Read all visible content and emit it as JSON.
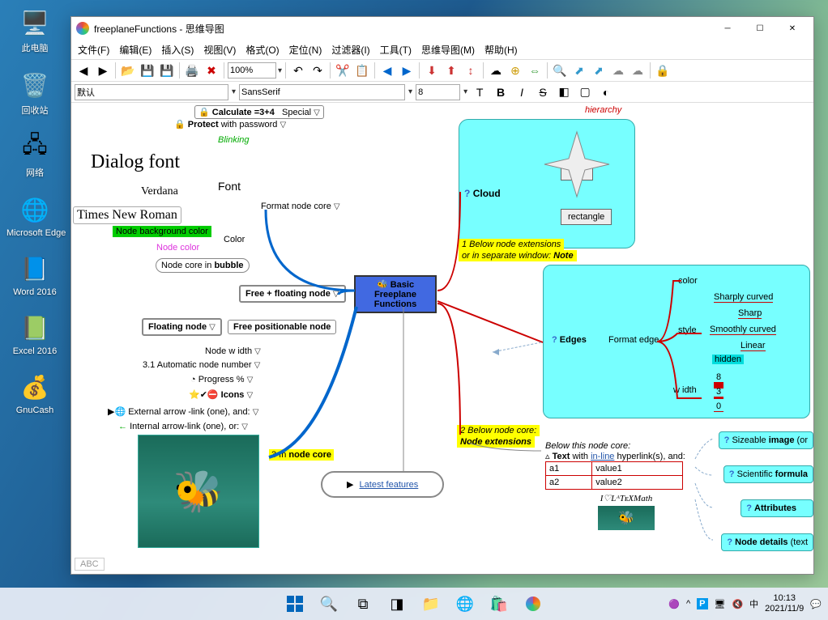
{
  "desktop": {
    "icons": [
      {
        "label": "此电脑",
        "glyph": "🖥️"
      },
      {
        "label": "回收站",
        "glyph": "🗑️"
      },
      {
        "label": "网络",
        "glyph": "🖧"
      },
      {
        "label": "Microsoft Edge",
        "glyph": "🌐"
      },
      {
        "label": "Word 2016",
        "glyph": "📘"
      },
      {
        "label": "Excel 2016",
        "glyph": "📗"
      },
      {
        "label": "GnuCash",
        "glyph": "💰"
      }
    ]
  },
  "window": {
    "title": "freeplaneFunctions - 思维导图",
    "menus": [
      "文件(F)",
      "编辑(E)",
      "插入(S)",
      "视图(V)",
      "格式(O)",
      "定位(N)",
      "过滤器(I)",
      "工具(T)",
      "思维导图(M)",
      "帮助(H)"
    ],
    "zoom": "100%",
    "style_combo": "默认",
    "font_combo": "SansSerif",
    "size_combo": "8",
    "status_left": "ABC"
  },
  "mm": {
    "root": "Basic Freeplane Functions",
    "latest_features": "Latest features",
    "calculate": "Calculate =3+4",
    "protect_label1": "Protect",
    "protect_label2": " with password",
    "blinking": "Blinking",
    "dialog_font": "Dialog font",
    "font_label": "Font",
    "verdana": "Verdana",
    "times": "Times New Roman",
    "format_node_core": "Format node core",
    "node_bg": "Node background color",
    "color": "Color",
    "node_color": "Node color",
    "node_bubble1": "Node core in ",
    "node_bubble2": "bubble",
    "free_floating": "Free + floating node",
    "floating": "Floating node",
    "free_position": "Free positionable node",
    "node_width": "Node w idth",
    "auto_number": "3.1 Automatic node number",
    "progress": "Progress %",
    "icons": "Icons",
    "ext_arrow": "External arrow -link (one), and:",
    "int_arrow": "Internal arrow-link (one), or:",
    "in_node_core": "3 In node core",
    "below1a": "1 Below node extensions",
    "below1b": "or in separate window: ",
    "below1c": "Note",
    "below2a": "2 Below node core:",
    "below2b": "Node extensions",
    "cloud": "Cloud",
    "star": "star",
    "rectangle": "rectangle",
    "hierarchy": "hierarchy",
    "edges": "Edges",
    "format_edge": "Format edge",
    "edge_color": "color",
    "edge_style": "style",
    "edge_width": "w idth",
    "sharply": "Sharply curved",
    "sharp": "Sharp",
    "smoothly": "Smoothly curved",
    "linear": "Linear",
    "hidden": "hidden",
    "w8": "8",
    "w3": "3",
    "w0": "0",
    "below_core": "Below this node core:",
    "text_with1": "Text",
    "text_with2": " with ",
    "text_with3": "in-line",
    "text_with4": " hyperlink(s), and:",
    "a1": "a1",
    "v1": "value1",
    "a2": "a2",
    "v2": "value2",
    "latex": "I♡LᴬTᴇXMath",
    "sizeable": "Sizeable ",
    "sizeable2": "image",
    "sizeable3": " (or",
    "scientific1": "Scientific ",
    "scientific2": "formula",
    "attributes": "Attributes",
    "node_details1": "Node details",
    "node_details2": " (text"
  },
  "taskbar": {
    "time": "10:13",
    "date": "2021/11/9",
    "ime": "中"
  }
}
